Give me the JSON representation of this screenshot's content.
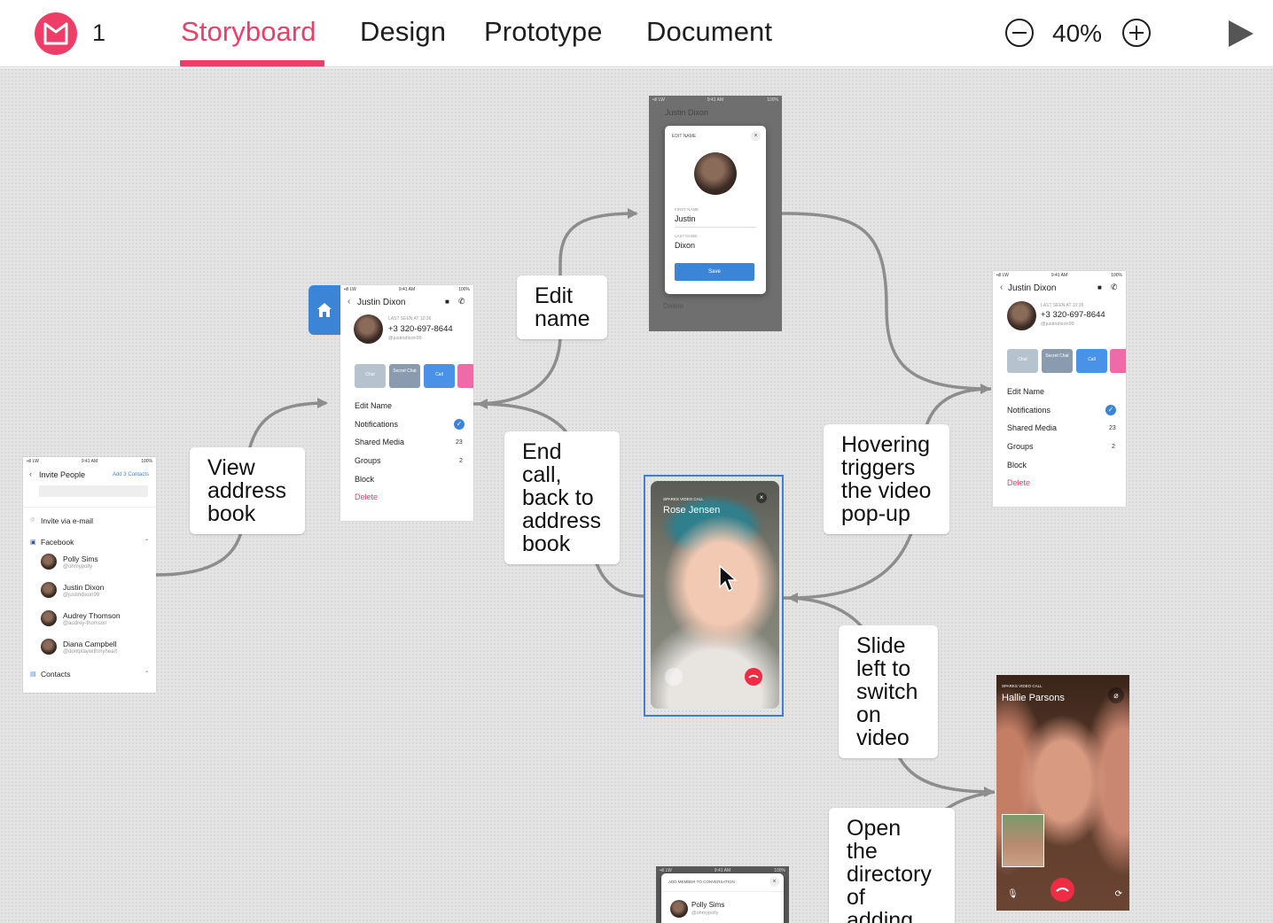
{
  "topbar": {
    "project_count": "1",
    "tabs": [
      {
        "label": "Storyboard",
        "active": true
      },
      {
        "label": "Design",
        "active": false
      },
      {
        "label": "Prototype",
        "active": false
      },
      {
        "label": "Document",
        "active": false
      }
    ],
    "zoom_level": "40%",
    "accent_color": "#ee3d66"
  },
  "labels": {
    "view_address_book": "View address book",
    "edit_name": "Edit name",
    "end_call": "End call, back to address book",
    "hovering": "Hovering triggers the video pop-up",
    "slide_left": "Slide left to switch on video",
    "open_directory": "Open the directory of adding"
  },
  "screens": {
    "invite": {
      "status_left": "•ıll LW",
      "status_time": "9:41 AM",
      "status_right": "100%",
      "title": "Invite People",
      "action": "Add 3 Contacts",
      "invite_email": "Invite via e-mail",
      "facebook": "Facebook",
      "contacts": [
        {
          "name": "Polly Sims",
          "handle": "@ohmypolly"
        },
        {
          "name": "Justin Dixon",
          "handle": "@justindixon99"
        },
        {
          "name": "Audrey Thomson",
          "handle": "@audrey-thomson"
        },
        {
          "name": "Diana Campbell",
          "handle": "@dontplaywithmyheart"
        }
      ],
      "contacts_section": "Contacts"
    },
    "profile": {
      "status_left": "•ıll LW",
      "status_time": "9:41 AM",
      "status_right": "100%",
      "name": "Justin Dixon",
      "last_seen": "LAST SEEN AT 10:36",
      "phone": "+3 320-697-8644",
      "handle": "@justindixon99",
      "buttons": [
        "Chat",
        "Secret Chat",
        "Call"
      ],
      "menu": [
        {
          "label": "Edit Name",
          "value": ""
        },
        {
          "label": "Notifications",
          "value": ""
        },
        {
          "label": "Shared Media",
          "value": "23"
        },
        {
          "label": "Groups",
          "value": "2"
        },
        {
          "label": "Block",
          "value": ""
        }
      ],
      "delete": "Delete"
    },
    "edit_name": {
      "status_left": "•ıll LW",
      "status_time": "9:41 AM",
      "status_right": "100%",
      "header_name": "Justin Dixon",
      "modal_title": "EDIT NAME",
      "first_name_label": "FIRST NAME",
      "first_name": "Justin",
      "last_name_label": "LAST NAME",
      "last_name": "Dixon",
      "save": "Save",
      "behind_delete": "Delete"
    },
    "video_call": {
      "caption": "SPARKS VIDEO CALL",
      "name": "Rose Jensen"
    },
    "video_call_2": {
      "caption": "SPARKS VIDEO CALL",
      "name": "Hallie Parsons"
    },
    "add_member": {
      "status_left": "•ıll LW",
      "status_time": "9:41 AM",
      "status_right": "100%",
      "title": "ADD MEMBER TO CONVERSATION",
      "contact_name": "Polly Sims",
      "contact_handle": "@ohmypolly"
    }
  }
}
